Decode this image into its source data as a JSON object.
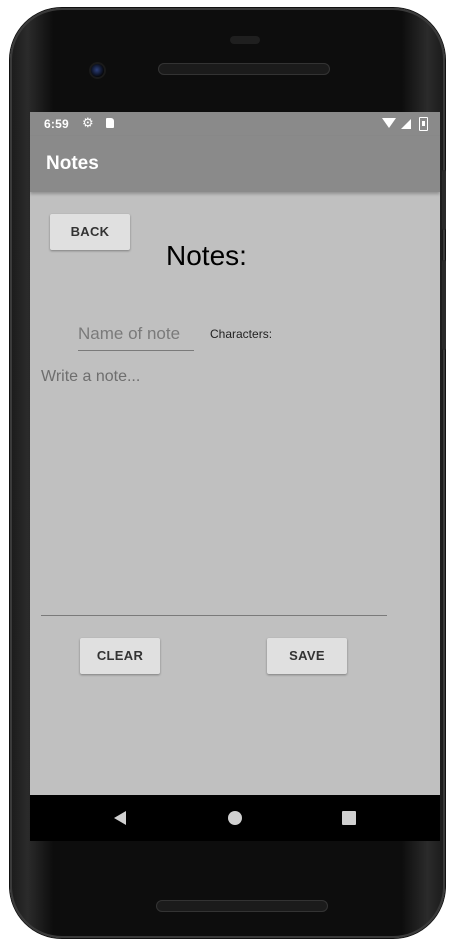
{
  "status_bar": {
    "time": "6:59",
    "icons": [
      "gear-icon",
      "sd-card-icon",
      "wifi-icon",
      "signal-icon",
      "battery-icon"
    ]
  },
  "app_bar": {
    "title": "Notes"
  },
  "main": {
    "back_label": "BACK",
    "heading": "Notes:",
    "name_placeholder": "Name of note",
    "characters_label": "Characters:",
    "note_placeholder": "Write a note...",
    "clear_label": "CLEAR",
    "save_label": "SAVE"
  },
  "nav_bar": {
    "icons": [
      "back-icon",
      "home-icon",
      "recents-icon"
    ]
  },
  "colors": {
    "app_bar": "#8a8a8a",
    "background": "#c0c0c0",
    "button": "#e0e0e0"
  }
}
